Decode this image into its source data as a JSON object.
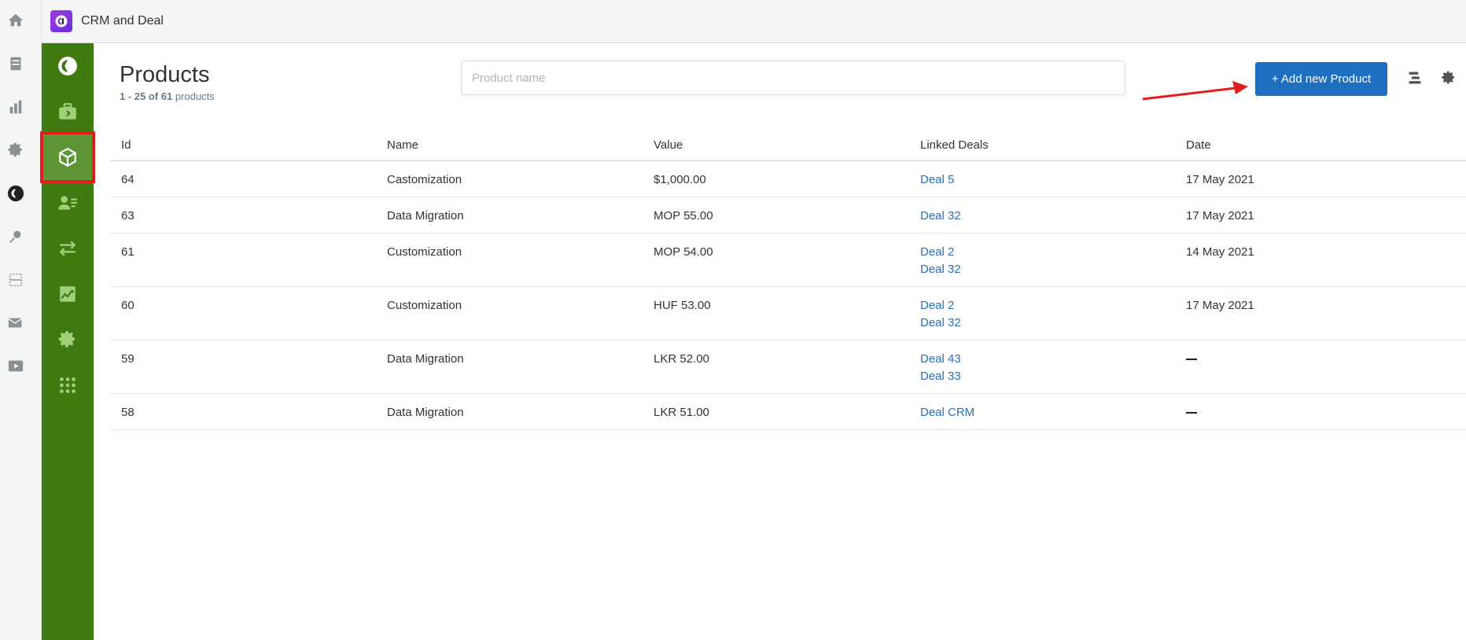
{
  "app": {
    "title": "CRM and Deal"
  },
  "page": {
    "title": "Products",
    "count_range": "1 - 25 of 61",
    "count_suffix": "products"
  },
  "search": {
    "placeholder": "Product name"
  },
  "toolbar": {
    "add_label": "+ Add new Product"
  },
  "table": {
    "headers": {
      "id": "Id",
      "name": "Name",
      "value": "Value",
      "linked_deals": "Linked Deals",
      "date": "Date"
    },
    "rows": [
      {
        "id": "64",
        "name": "Castomization",
        "value": "$1,000.00",
        "deals": [
          "Deal 5"
        ],
        "date": "17 May 2021"
      },
      {
        "id": "63",
        "name": "Data Migration",
        "value": "MOP 55.00",
        "deals": [
          "Deal 32"
        ],
        "date": "17 May 2021"
      },
      {
        "id": "61",
        "name": "Customization",
        "value": "MOP 54.00",
        "deals": [
          "Deal 2",
          "Deal 32"
        ],
        "date": "14 May 2021"
      },
      {
        "id": "60",
        "name": "Customization",
        "value": "HUF 53.00",
        "deals": [
          "Deal 2",
          "Deal 32"
        ],
        "date": "17 May 2021"
      },
      {
        "id": "59",
        "name": "Data Migration",
        "value": "LKR 52.00",
        "deals": [
          "Deal 43",
          "Deal 33"
        ],
        "date": ""
      },
      {
        "id": "58",
        "name": "Data Migration",
        "value": "LKR 51.00",
        "deals": [
          "Deal CRM"
        ],
        "date": ""
      }
    ]
  },
  "colors": {
    "sidebar_green": "#3e7a0f",
    "active_item": "#5f9635",
    "highlight": "#e11d1d",
    "button_blue": "#1e6fbf",
    "link_blue": "#2a6fb8"
  },
  "icons": {
    "outer_rail": [
      "home-icon",
      "archive-icon",
      "bar-chart-icon",
      "gear-icon",
      "app-logo-icon",
      "search-person-icon",
      "divider-icon",
      "mail-check-icon",
      "play-icon"
    ],
    "green_sidebar": [
      "logo-icon",
      "briefcase-icon",
      "product-box-icon",
      "contacts-icon",
      "transfer-icon",
      "analytics-icon",
      "settings-icon",
      "apps-grid-icon"
    ]
  }
}
